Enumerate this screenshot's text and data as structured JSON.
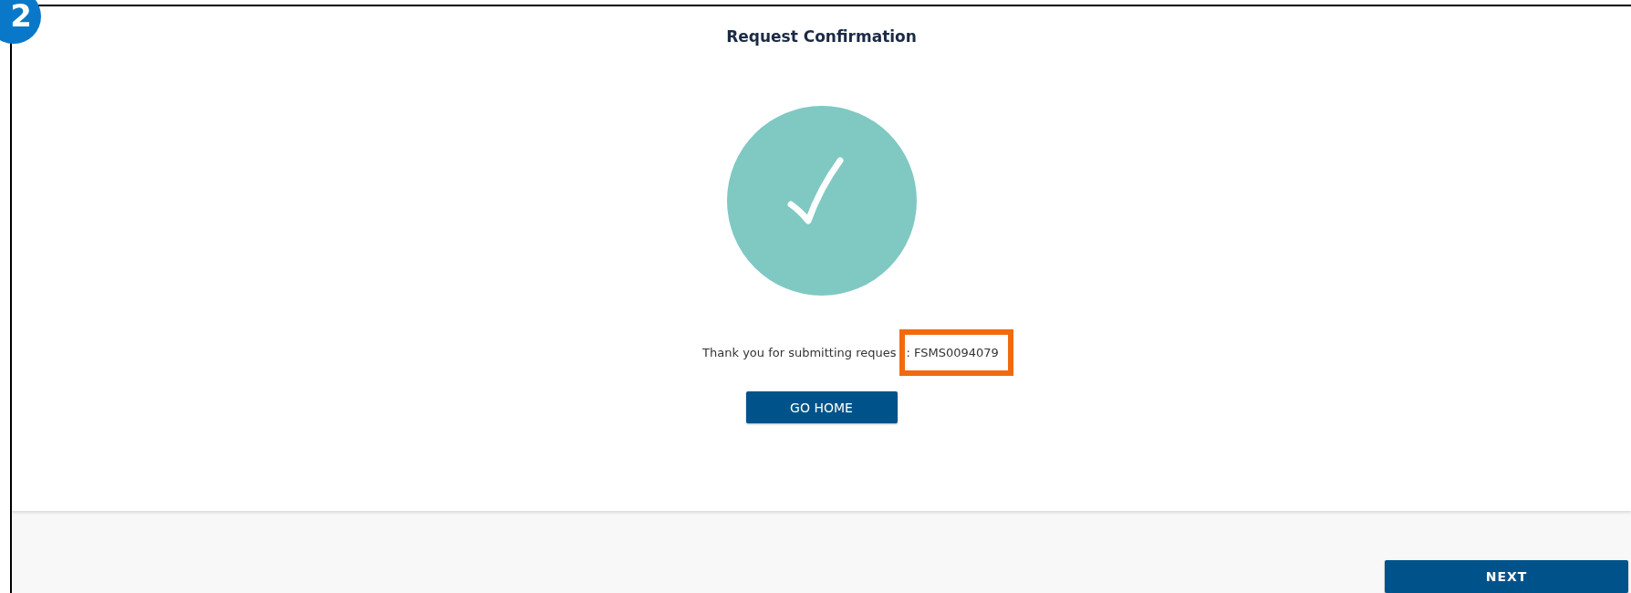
{
  "step_badge": "2",
  "title": "Request Confirmation",
  "message": {
    "text": "Thank you for submitting reques",
    "highlighted": ": FSMS0094079"
  },
  "buttons": [
    {
      "label": "GO HOME",
      "kind": "primary"
    }
  ],
  "footer": {
    "buttons": [
      {
        "label": "NEXT",
        "kind": "primary"
      }
    ]
  }
}
